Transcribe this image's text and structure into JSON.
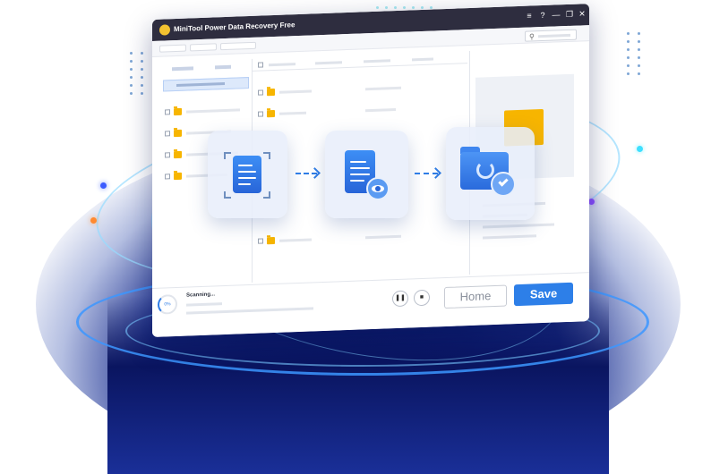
{
  "window": {
    "title": "MiniTool Power Data Recovery Free",
    "menu_icon": "≡",
    "help_icon": "?",
    "minimize_icon": "—",
    "maximize_icon": "❐",
    "close_icon": "✕"
  },
  "search": {
    "icon": "⚲"
  },
  "status": {
    "scanning_label": "Scanning...",
    "progress_label": "0%",
    "pause_icon": "❚❚",
    "stop_icon": "■"
  },
  "buttons": {
    "home_label": "Home",
    "save_label": "Save"
  },
  "steps": [
    {
      "name": "scan",
      "icon": "document-scan-icon"
    },
    {
      "name": "preview",
      "icon": "document-preview-icon"
    },
    {
      "name": "recover",
      "icon": "folder-recover-icon"
    }
  ],
  "colors": {
    "accent": "#2D7FE8",
    "titlebar": "#2E2D3F",
    "folder": "#F7B500",
    "glow": "#0C1F7A"
  }
}
